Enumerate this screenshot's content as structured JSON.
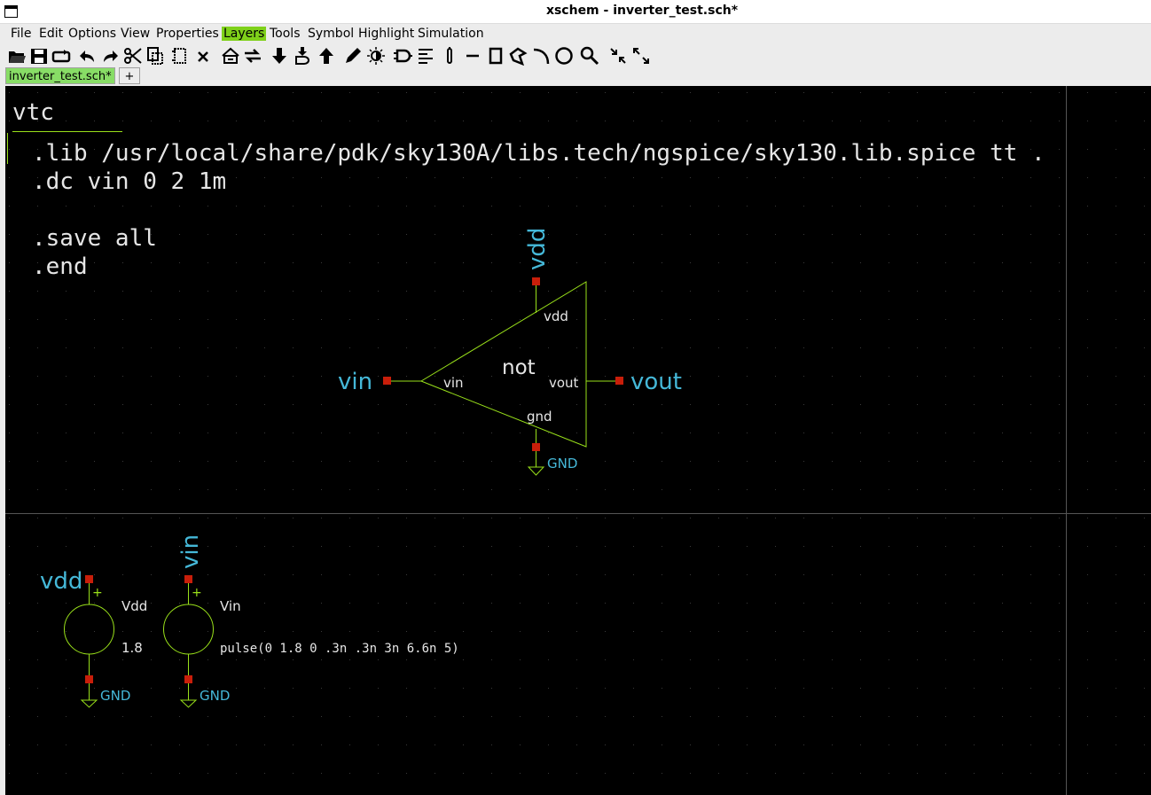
{
  "window": {
    "title": "xschem - inverter_test.sch*"
  },
  "menu": [
    "File",
    "Edit",
    "Options",
    "View",
    "Properties",
    "Layers",
    "Tools",
    "Symbol",
    "Highlight",
    "Simulation"
  ],
  "menu_active": "Layers",
  "toolbar_icons": [
    "open-icon",
    "save-icon",
    "reload-icon",
    "undo-icon",
    "redo-icon",
    "cut-icon",
    "copy-icon",
    "move-icon",
    "delete-icon",
    "push-icon",
    "swap-icon",
    "descend-icon",
    "descend-symbol-icon",
    "ascend-icon",
    "edit-wire-icon",
    "highlight-icon",
    "insert-symbol-icon",
    "align-icon",
    "pin-icon",
    "line-icon",
    "rect-icon",
    "polygon-icon",
    "arc-icon",
    "circle-icon",
    "zoom-icon",
    "zoom-in-icon",
    "zoom-full-icon"
  ],
  "tabs": {
    "active": "inverter_test.sch*",
    "add": "+"
  },
  "schematic": {
    "netlist_title": "vtc",
    "code_lines": [
      ".lib /usr/local/share/pdk/sky130A/libs.tech/ngspice/sky130.lib.spice tt .",
      ".dc vin 0 2 1m",
      "",
      ".save all",
      ".end"
    ],
    "inverter": {
      "name": "not",
      "pin_in": "vin",
      "pin_out": "vout",
      "pin_vdd": "vdd",
      "pin_gnd": "gnd",
      "net_in": "vin",
      "net_out": "vout",
      "net_vdd": "vdd",
      "net_gnd": "GND"
    },
    "vdd_source": {
      "name": "Vdd",
      "value": "1.8",
      "net": "vdd",
      "gnd": "GND",
      "plus": "+"
    },
    "vin_source": {
      "name": "Vin",
      "value": "pulse(0 1.8 0 .3n .3n 3n 6.6n 5)",
      "net": "vin",
      "gnd": "GND",
      "plus": "+"
    }
  },
  "colors": {
    "canvas": "#000000",
    "wire": "#99e01a",
    "text": "#e6e6e6",
    "net_label": "#45b8d8",
    "pin": "#c81e0a",
    "grid": "#3a3a3a",
    "menu_highlight": "#7fd11a",
    "tab_active": "#88dd66"
  }
}
